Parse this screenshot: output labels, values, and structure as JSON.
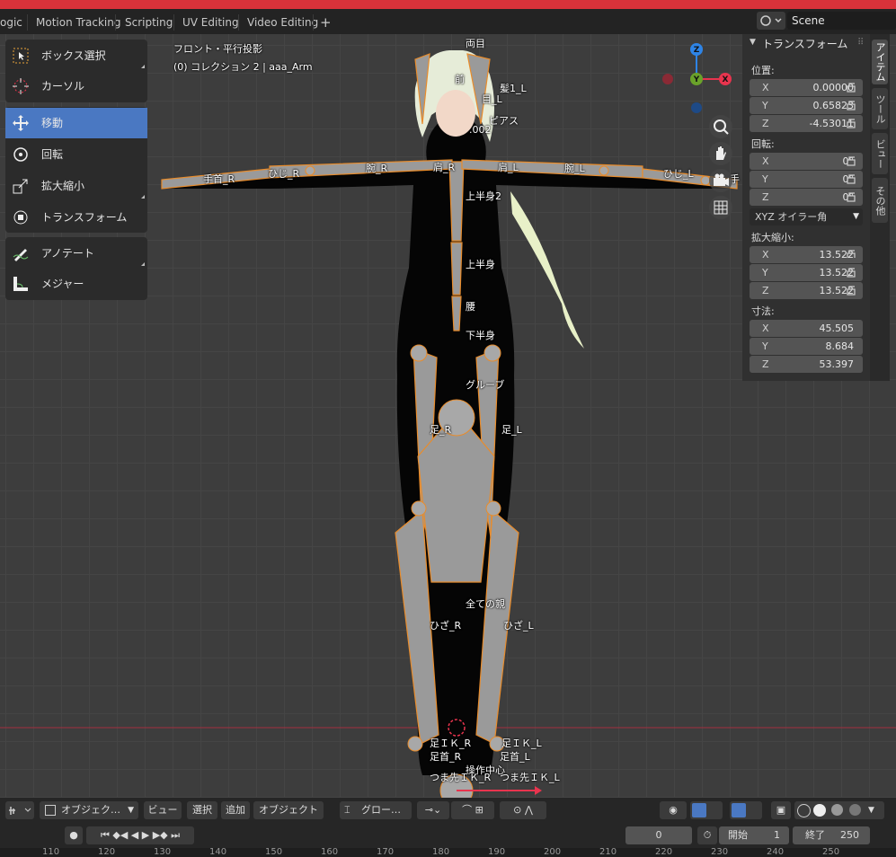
{
  "topbar": {
    "tabs": [
      "ogic",
      "Motion Tracking",
      "Scripting",
      "UV Editing",
      "Video Editing"
    ],
    "add_tab": "+",
    "scene_label": "Scene"
  },
  "viewport": {
    "view_name": "フロント・平行投影",
    "collection_info": "(0) コレクション 2 | aaa_Arm"
  },
  "toolbar": {
    "tools": [
      "ボックス選択",
      "カーソル",
      "移動",
      "回転",
      "拡大縮小",
      "トランスフォーム",
      "アノテート",
      "メジャー"
    ],
    "active_tool": "移動"
  },
  "bones": [
    {
      "label": "両目"
    },
    {
      "label": "前"
    },
    {
      "label": "髪1_L"
    },
    {
      "label": "目_L"
    },
    {
      "label": "ピアス"
    },
    {
      "label": ".002"
    },
    {
      "label": "肩_R"
    },
    {
      "label": "肩_L"
    },
    {
      "label": "腕_R"
    },
    {
      "label": "腕_L"
    },
    {
      "label": "ひじ_R"
    },
    {
      "label": "ひじ_L"
    },
    {
      "label": "手首_R"
    },
    {
      "label": "手"
    },
    {
      "label": "上半身2"
    },
    {
      "label": "上半身"
    },
    {
      "label": "腰"
    },
    {
      "label": "下半身"
    },
    {
      "label": "グルーブ"
    },
    {
      "label": "足_R"
    },
    {
      "label": "足_L"
    },
    {
      "label": "全ての親"
    },
    {
      "label": "ひざ_R"
    },
    {
      "label": "ひざ_L"
    },
    {
      "label": "足ＩＫ_R"
    },
    {
      "label": "足ＩＫ_L"
    },
    {
      "label": "足首_R"
    },
    {
      "label": "足首_L"
    },
    {
      "label": "操作中心"
    },
    {
      "label": "つま先ＩＫ_R"
    },
    {
      "label": "つま先ＩＫ_L"
    }
  ],
  "gizmo": {
    "x": "X",
    "y": "Y",
    "z": "Z",
    "colors": {
      "x": "#e8344e",
      "y": "#6aa22a",
      "z": "#2e84e6"
    }
  },
  "npanel": {
    "title": "トランスフォーム",
    "location_label": "位置:",
    "location": [
      {
        "axis": "X",
        "value": "0.00000"
      },
      {
        "axis": "Y",
        "value": "0.65823"
      },
      {
        "axis": "Z",
        "value": "-4.53011"
      }
    ],
    "rotation_label": "回転:",
    "rotation": [
      {
        "axis": "X",
        "value": "0°"
      },
      {
        "axis": "Y",
        "value": "0°"
      },
      {
        "axis": "Z",
        "value": "0°"
      }
    ],
    "rotation_mode": "XYZ オイラー角",
    "scale_label": "拡大縮小:",
    "scale": [
      {
        "axis": "X",
        "value": "13.522"
      },
      {
        "axis": "Y",
        "value": "13.522"
      },
      {
        "axis": "Z",
        "value": "13.522"
      }
    ],
    "dimensions_label": "寸法:",
    "dimensions": [
      {
        "axis": "X",
        "value": "45.505"
      },
      {
        "axis": "Y",
        "value": "8.684"
      },
      {
        "axis": "Z",
        "value": "53.397"
      }
    ],
    "tabs": [
      "アイテム",
      "ツール",
      "ビュー",
      "その他"
    ]
  },
  "header": {
    "mode": "オブジェク…",
    "menus": [
      "ビュー",
      "選択",
      "追加",
      "オブジェクト"
    ],
    "orientation": "グロー…"
  },
  "timeline": {
    "current_frame": "0",
    "start_label": "開始",
    "start": "1",
    "end_label": "終了",
    "end": "250"
  },
  "ruler": {
    "ticks": [
      "110",
      "120",
      "130",
      "140",
      "150",
      "160",
      "170",
      "180",
      "190",
      "200",
      "210",
      "220",
      "230",
      "240",
      "250"
    ]
  },
  "colors": {
    "accent": "#4a78c2",
    "redbar": "#d8323a",
    "selected_outline": "#e88c2c",
    "bone_fill": "#9a9a9a"
  }
}
